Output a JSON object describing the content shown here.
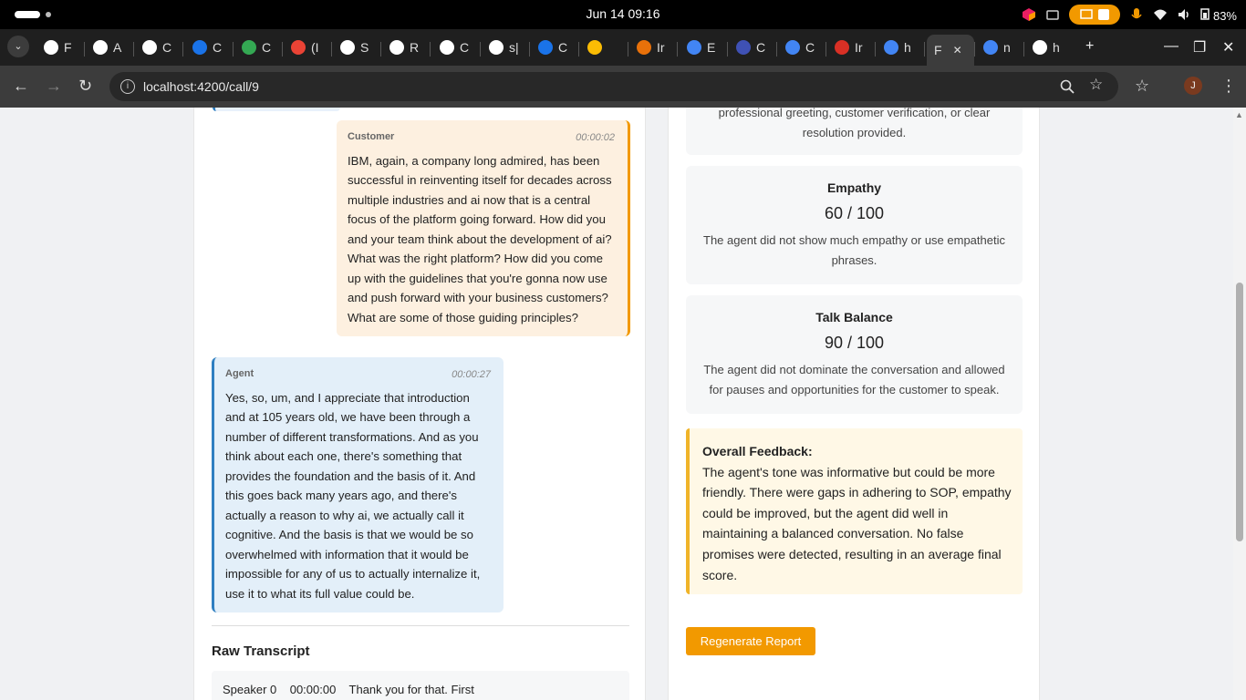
{
  "os": {
    "clock": "Jun 14  09:16",
    "battery": "83%"
  },
  "tabs": [
    {
      "label": "F",
      "color": "#ffffff"
    },
    {
      "label": "A",
      "color": "#ffffff"
    },
    {
      "label": "C",
      "color": "#ffffff"
    },
    {
      "label": "C",
      "color": "#1a73e8"
    },
    {
      "label": "C",
      "color": "#34a853"
    },
    {
      "label": "(I",
      "color": "#ea4335"
    },
    {
      "label": "S",
      "color": "#ffffff"
    },
    {
      "label": "R",
      "color": "#ffffff"
    },
    {
      "label": "C",
      "color": "#ffffff"
    },
    {
      "label": "s|",
      "color": "#ffffff"
    },
    {
      "label": "C",
      "color": "#1a73e8"
    },
    {
      "label": "",
      "color": "#fbbc04"
    },
    {
      "label": "Ir",
      "color": "#e8710a"
    },
    {
      "label": "E",
      "color": "#4285f4"
    },
    {
      "label": "C",
      "color": "#3f51b5"
    },
    {
      "label": "C",
      "color": "#4285f4"
    },
    {
      "label": "Ir",
      "color": "#d93025"
    },
    {
      "label": "h",
      "color": "#4285f4"
    },
    {
      "label": "F",
      "color": "#888888"
    },
    {
      "label": "n",
      "color": "#4285f4"
    },
    {
      "label": "h",
      "color": "#ffffff"
    }
  ],
  "address": {
    "url": "localhost:4200/call/9"
  },
  "profile": {
    "initial": "J"
  },
  "transcript": {
    "customer": {
      "speaker": "Customer",
      "time": "00:00:02",
      "text": "IBM, again, a company long admired, has been successful in reinventing itself for decades across multiple industries and ai now that is a central focus of the platform going forward. How did you and your team think about the development of ai? What was the right platform? How did you come up with the guidelines that you're gonna now use and push forward with your business customers? What are some of those guiding principles?"
    },
    "agent": {
      "speaker": "Agent",
      "time": "00:00:27",
      "text": "Yes, so, um, and I appreciate that introduction and at 105 years old, we have been through a number of different transformations. And as you think about each one, there's something that provides the foundation and the basis of it. And this goes back many years ago, and there's actually a reason to why ai, we actually call it cognitive. And the basis is that we would be so overwhelmed with information that it would be impossible for any of us to actually internalize it, use it to what its full value could be."
    },
    "raw_title": "Raw Transcript",
    "raw_first_line": "Speaker 0    00:00:00    Thank you for that. First"
  },
  "report": {
    "top_partial": "professional greeting, customer verification, or clear resolution provided.",
    "empathy": {
      "name": "Empathy",
      "score": "60 / 100",
      "desc": "The agent did not show much empathy or use empathetic phrases."
    },
    "talk_balance": {
      "name": "Talk Balance",
      "score": "90 / 100",
      "desc": "The agent did not dominate the conversation and allowed for pauses and opportunities for the customer to speak."
    },
    "overall": {
      "heading": "Overall Feedback:",
      "text": "The agent's tone was informative but could be more friendly. There were gaps in adhering to SOP, empathy could be improved, but the agent did well in maintaining a balanced conversation. No false promises were detected, resulting in an average final score."
    },
    "regenerate_label": "Regenerate Report"
  }
}
